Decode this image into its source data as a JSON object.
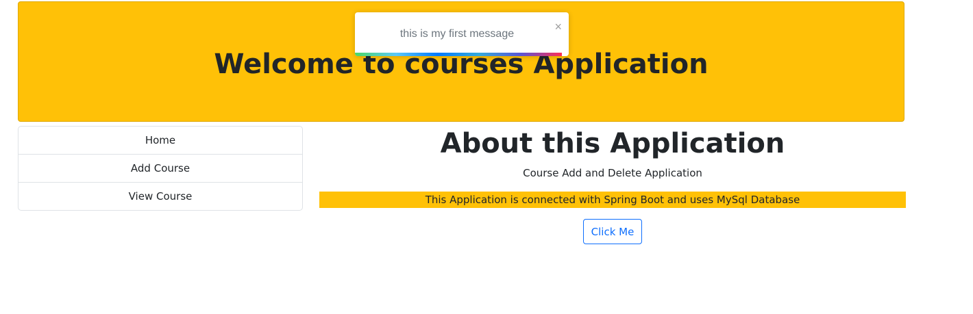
{
  "header": {
    "title": "Welcome to courses Application",
    "background": "#ffc107"
  },
  "toast": {
    "message": "this is my first message",
    "close_symbol": "×",
    "close_icon": "close-icon"
  },
  "sidebar": {
    "items": [
      {
        "label": "Home"
      },
      {
        "label": "Add Course"
      },
      {
        "label": "View Course"
      }
    ]
  },
  "main": {
    "title": "About this Application",
    "subtitle": "Course Add and Delete Application",
    "info_text": "This Application is connected with Spring Boot and uses MySql Database",
    "button_label": "Click Me"
  },
  "colors": {
    "warning": "#ffc107",
    "primary": "#0d6efd",
    "text": "#212529"
  }
}
